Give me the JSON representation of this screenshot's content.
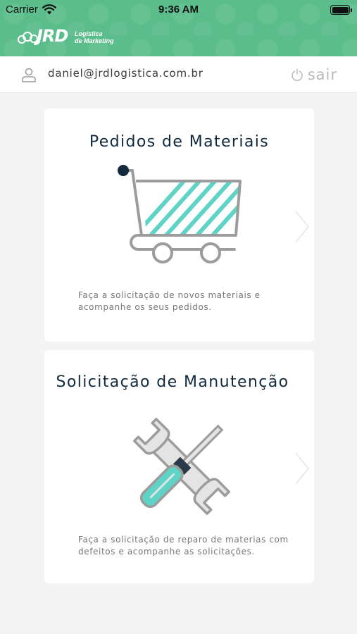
{
  "status_bar": {
    "carrier": "Carrier",
    "time": "9:36 AM"
  },
  "header": {
    "logo_brand": "JRD",
    "logo_tagline_line1": "Logística",
    "logo_tagline_line2": "de Marketing",
    "background_color": "#5cbd8c"
  },
  "user_bar": {
    "email": "daniel@jrdlogistica.com.br",
    "logout_label": "sair",
    "user_icon": "user-icon",
    "logout_icon": "power-icon"
  },
  "cards": [
    {
      "title": "Pedidos de Materiais",
      "description": "Faça a solicitação de novos materiais e acompanhe os seus pedidos.",
      "icon": "shopping-cart-icon"
    },
    {
      "title": "Solicitação de Manutenção",
      "description": "Faça a solicitação de reparo de materias com defeitos e acompanhe as solicitações.",
      "icon": "tools-icon"
    }
  ],
  "colors": {
    "accent": "#5fd3c6",
    "title": "#122a3e",
    "icon_stroke": "#a3a3a3"
  }
}
